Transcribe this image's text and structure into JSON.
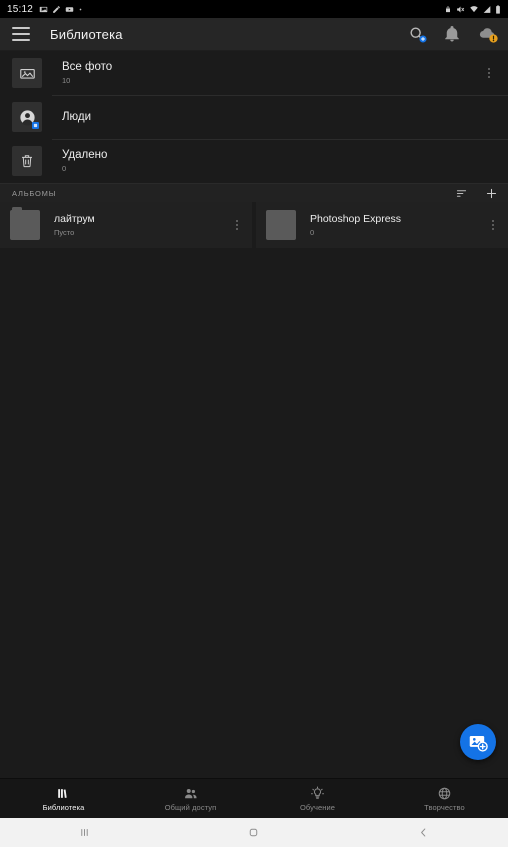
{
  "status_bar": {
    "clock": "15:12",
    "left_icons": [
      "photos-icon",
      "edit-icon",
      "youtube-icon",
      "dot-icon"
    ],
    "right_icons": [
      "lock-icon",
      "mute-icon",
      "wifi-icon",
      "signal-icon",
      "battery-icon"
    ]
  },
  "app_bar": {
    "menu_icon": "hamburger-icon",
    "title": "Библиотека",
    "actions": [
      {
        "name": "search-icon",
        "badge": true,
        "badge_color": "#1473e6"
      },
      {
        "name": "bell-icon",
        "badge": false
      },
      {
        "name": "cloud-icon",
        "badge": true,
        "badge_color": "#e8a01e"
      }
    ]
  },
  "library": {
    "rows": [
      {
        "icon": "all-photos-icon",
        "title": "Все фото",
        "count": "10",
        "menu": "kebab-icon"
      },
      {
        "icon": "people-icon",
        "title": "Люди",
        "count": "",
        "menu": ""
      },
      {
        "icon": "trash-icon",
        "title": "Удалено",
        "count": "0",
        "menu": ""
      }
    ]
  },
  "albums_header": {
    "label": "АЛЬБОМЫ",
    "sort_icon": "sort-icon",
    "add_icon": "plus-icon"
  },
  "albums": [
    {
      "title": "лайтрум",
      "subtitle": "Пусто",
      "cover": "folder-cover",
      "menu": "kebab-icon"
    },
    {
      "title": "Photoshop Express",
      "subtitle": "0",
      "cover": "plain-cover",
      "menu": "kebab-icon"
    }
  ],
  "fab": {
    "name": "add-photos-fab",
    "icon": "add-photo-icon",
    "color": "#1473e6"
  },
  "tabs": [
    {
      "label": "Библиотека",
      "icon": "books-icon",
      "active": true
    },
    {
      "label": "Общий доступ",
      "icon": "people-group-icon",
      "active": false
    },
    {
      "label": "Обучение",
      "icon": "lightbulb-icon",
      "active": false
    },
    {
      "label": "Творчество",
      "icon": "globe-icon",
      "active": false
    }
  ],
  "android_nav": {
    "recents": "recents-icon",
    "home": "home-icon",
    "back": "back-icon"
  }
}
